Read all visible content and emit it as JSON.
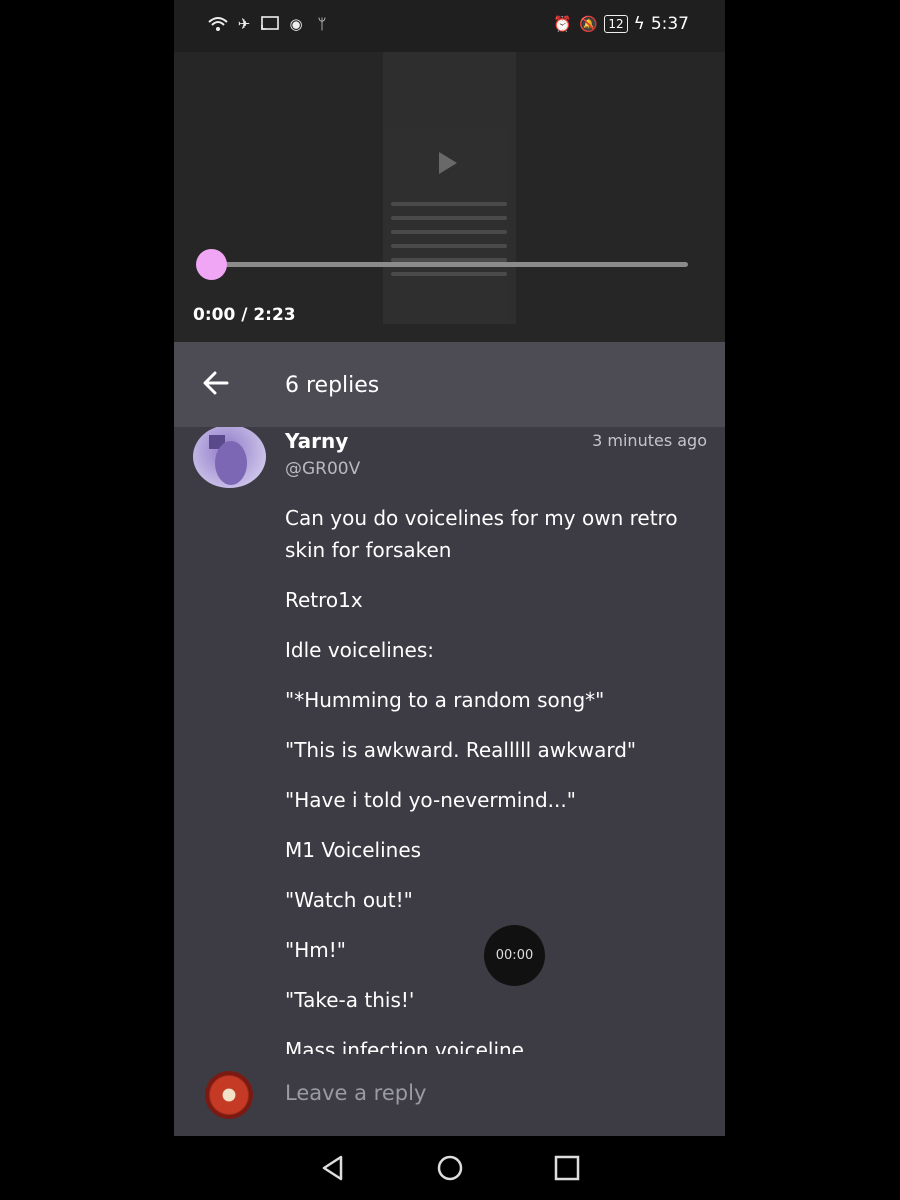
{
  "status_bar": {
    "time": "5:37",
    "battery": "12",
    "left_icons": [
      "wifi-icon",
      "airplane-icon",
      "cast-icon",
      "record-icon",
      "usb-icon"
    ],
    "right_icons": [
      "alarm-icon",
      "mute-icon"
    ]
  },
  "video": {
    "time_display": "0:00 / 2:23",
    "progress": 0.0
  },
  "thread": {
    "back_icon": "arrow-left-icon",
    "title": "6 replies"
  },
  "comment": {
    "author": "Yarny",
    "handle": "@GR00V",
    "time_ago": "3 minutes ago",
    "lines": [
      "Can you do voicelines for my own retro skin for forsaken",
      "Retro1x",
      "Idle voicelines:",
      "\"*Humming to a random song*\"",
      "\"This is awkward. Realllll awkward\"",
      "\"Have i told yo-nevermind...\"",
      "M1 Voicelines",
      "\"Watch out!\"",
      "\"Hm!\"",
      "\"Take-a this!'",
      "Mass infection voiceline"
    ]
  },
  "timer_badge": "00:00",
  "reply": {
    "placeholder": "Leave a reply"
  },
  "nav": {
    "icons": [
      "back-triangle-icon",
      "home-circle-icon",
      "recents-square-icon"
    ]
  }
}
